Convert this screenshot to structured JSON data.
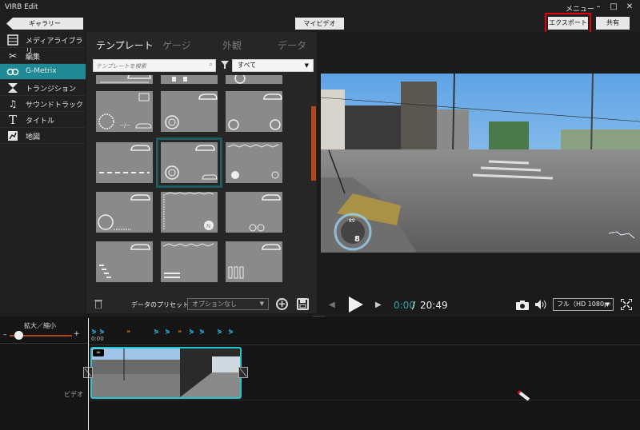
{
  "app": {
    "title": "VIRB Edit",
    "menu_label": "メニュー"
  },
  "window_controls": {
    "minimize": "–",
    "maximize": "□",
    "close": "✕"
  },
  "top_bar": {
    "gallery_button": "ギャラリー",
    "my_video_button": "マイビデオ",
    "export_button": "エクスポート",
    "share_button": "共有"
  },
  "sidebar": {
    "items": [
      {
        "label": "メディアライブラリ",
        "icon": "film-icon",
        "active": false
      },
      {
        "label": "編集",
        "icon": "scissors-icon",
        "active": false
      },
      {
        "label": "G-Metrix",
        "icon": "gmetrix-icon",
        "active": true
      },
      {
        "label": "トランジション",
        "icon": "transition-icon",
        "active": false
      },
      {
        "label": "サウンドトラック",
        "icon": "music-note-icon",
        "active": false
      },
      {
        "label": "タイトル",
        "icon": "title-t-icon",
        "active": false
      },
      {
        "label": "地図",
        "icon": "map-icon",
        "active": false
      }
    ]
  },
  "template_panel": {
    "tabs": [
      {
        "label": "テンプレート",
        "active": true
      },
      {
        "label": "ゲージ",
        "active": false
      },
      {
        "label": "外観",
        "active": false
      },
      {
        "label": "データ",
        "active": false
      }
    ],
    "search_placeholder": "テンプレートを検索",
    "filter_value": "すべて",
    "selected_template_index": 4,
    "preset_label": "データのプリセット：",
    "preset_value": "オプションなし"
  },
  "preview": {
    "time_current": "0:00",
    "time_separator": "/",
    "time_total": "20:49",
    "quality_value": "フル（HD 1080p）",
    "overlay_heading": "89",
    "overlay_speed": "8"
  },
  "timeline": {
    "zoom_label": "拡大／縮小",
    "zoom_minus": "–",
    "zoom_plus": "+",
    "ruler_start": "0:00",
    "zoom_level": 0.15,
    "track_label": "ビデオ",
    "markers": [
      "blue",
      "blue",
      "orange",
      "blue",
      "blue",
      "orange",
      "blue",
      "blue",
      "blue",
      "blue"
    ]
  },
  "colors": {
    "accent": "#1f8a96",
    "highlight_red": "#e8000b",
    "time_accent": "#2aa6ad",
    "scroll_thumb": "#b5461c",
    "clip_border": "#23c7d0"
  }
}
